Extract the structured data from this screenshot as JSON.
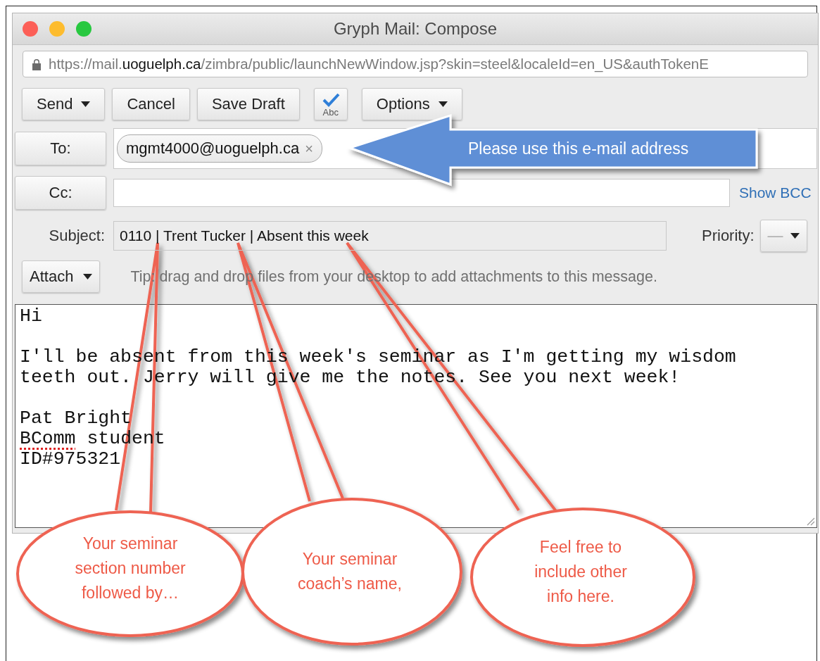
{
  "window": {
    "title": "Gryph Mail: Compose"
  },
  "address_bar": {
    "url_parts": [
      {
        "text": "https://mail.",
        "highlighted": false
      },
      {
        "text": "uoguelph.ca",
        "highlighted": true
      },
      {
        "text": "/zimbra/public/launchNewWindow.jsp?skin=steel&localeId=en_US&authTokenE",
        "highlighted": false
      }
    ]
  },
  "toolbar": [
    {
      "kind": "menu",
      "label": "Send"
    },
    {
      "kind": "button",
      "label": "Cancel"
    },
    {
      "kind": "button",
      "label": "Save Draft"
    },
    {
      "kind": "spellcheck",
      "label": "Abc"
    },
    {
      "kind": "menu",
      "label": "Options"
    }
  ],
  "to": {
    "label": "To:",
    "recipients": [
      {
        "address": "mgmt4000@uoguelph.ca",
        "remove": "×"
      }
    ]
  },
  "cc": {
    "label": "Cc:",
    "link": "Show BCC"
  },
  "subject": {
    "label": "Subject:",
    "value": "0110 | Trent Tucker | Absent this week"
  },
  "priority": {
    "label": "Priority:",
    "value": "—"
  },
  "attach": {
    "label": "Attach",
    "tip": "Tip: drag and drop files from your desktop to add attachments to this message."
  },
  "body": {
    "paragraphs": [
      [
        [
          {
            "text": "Hi",
            "misspelled": false
          }
        ]
      ],
      [
        [
          {
            "text": "I'll be absent from this week's seminar as I'm getting my wisdom",
            "misspelled": false
          }
        ],
        [
          {
            "text": "teeth out. Jerry will give me the notes. See you next week!",
            "misspelled": false
          }
        ]
      ],
      [
        [
          {
            "text": "Pat Bright",
            "misspelled": false
          }
        ],
        [
          {
            "text": "BComm",
            "misspelled": true
          },
          {
            "text": " student",
            "misspelled": false
          }
        ],
        [
          {
            "text": "ID#975321",
            "misspelled": false
          }
        ]
      ]
    ]
  },
  "annotations": {
    "arrow": {
      "text": "Please use this e-mail address"
    },
    "callouts": [
      {
        "lines": [
          "Your seminar",
          "section number",
          "followed by…"
        ]
      },
      {
        "lines": [
          "Your seminar",
          "coach’s name,"
        ]
      },
      {
        "lines": [
          "Feel free to",
          "include other",
          "info here."
        ]
      }
    ]
  }
}
